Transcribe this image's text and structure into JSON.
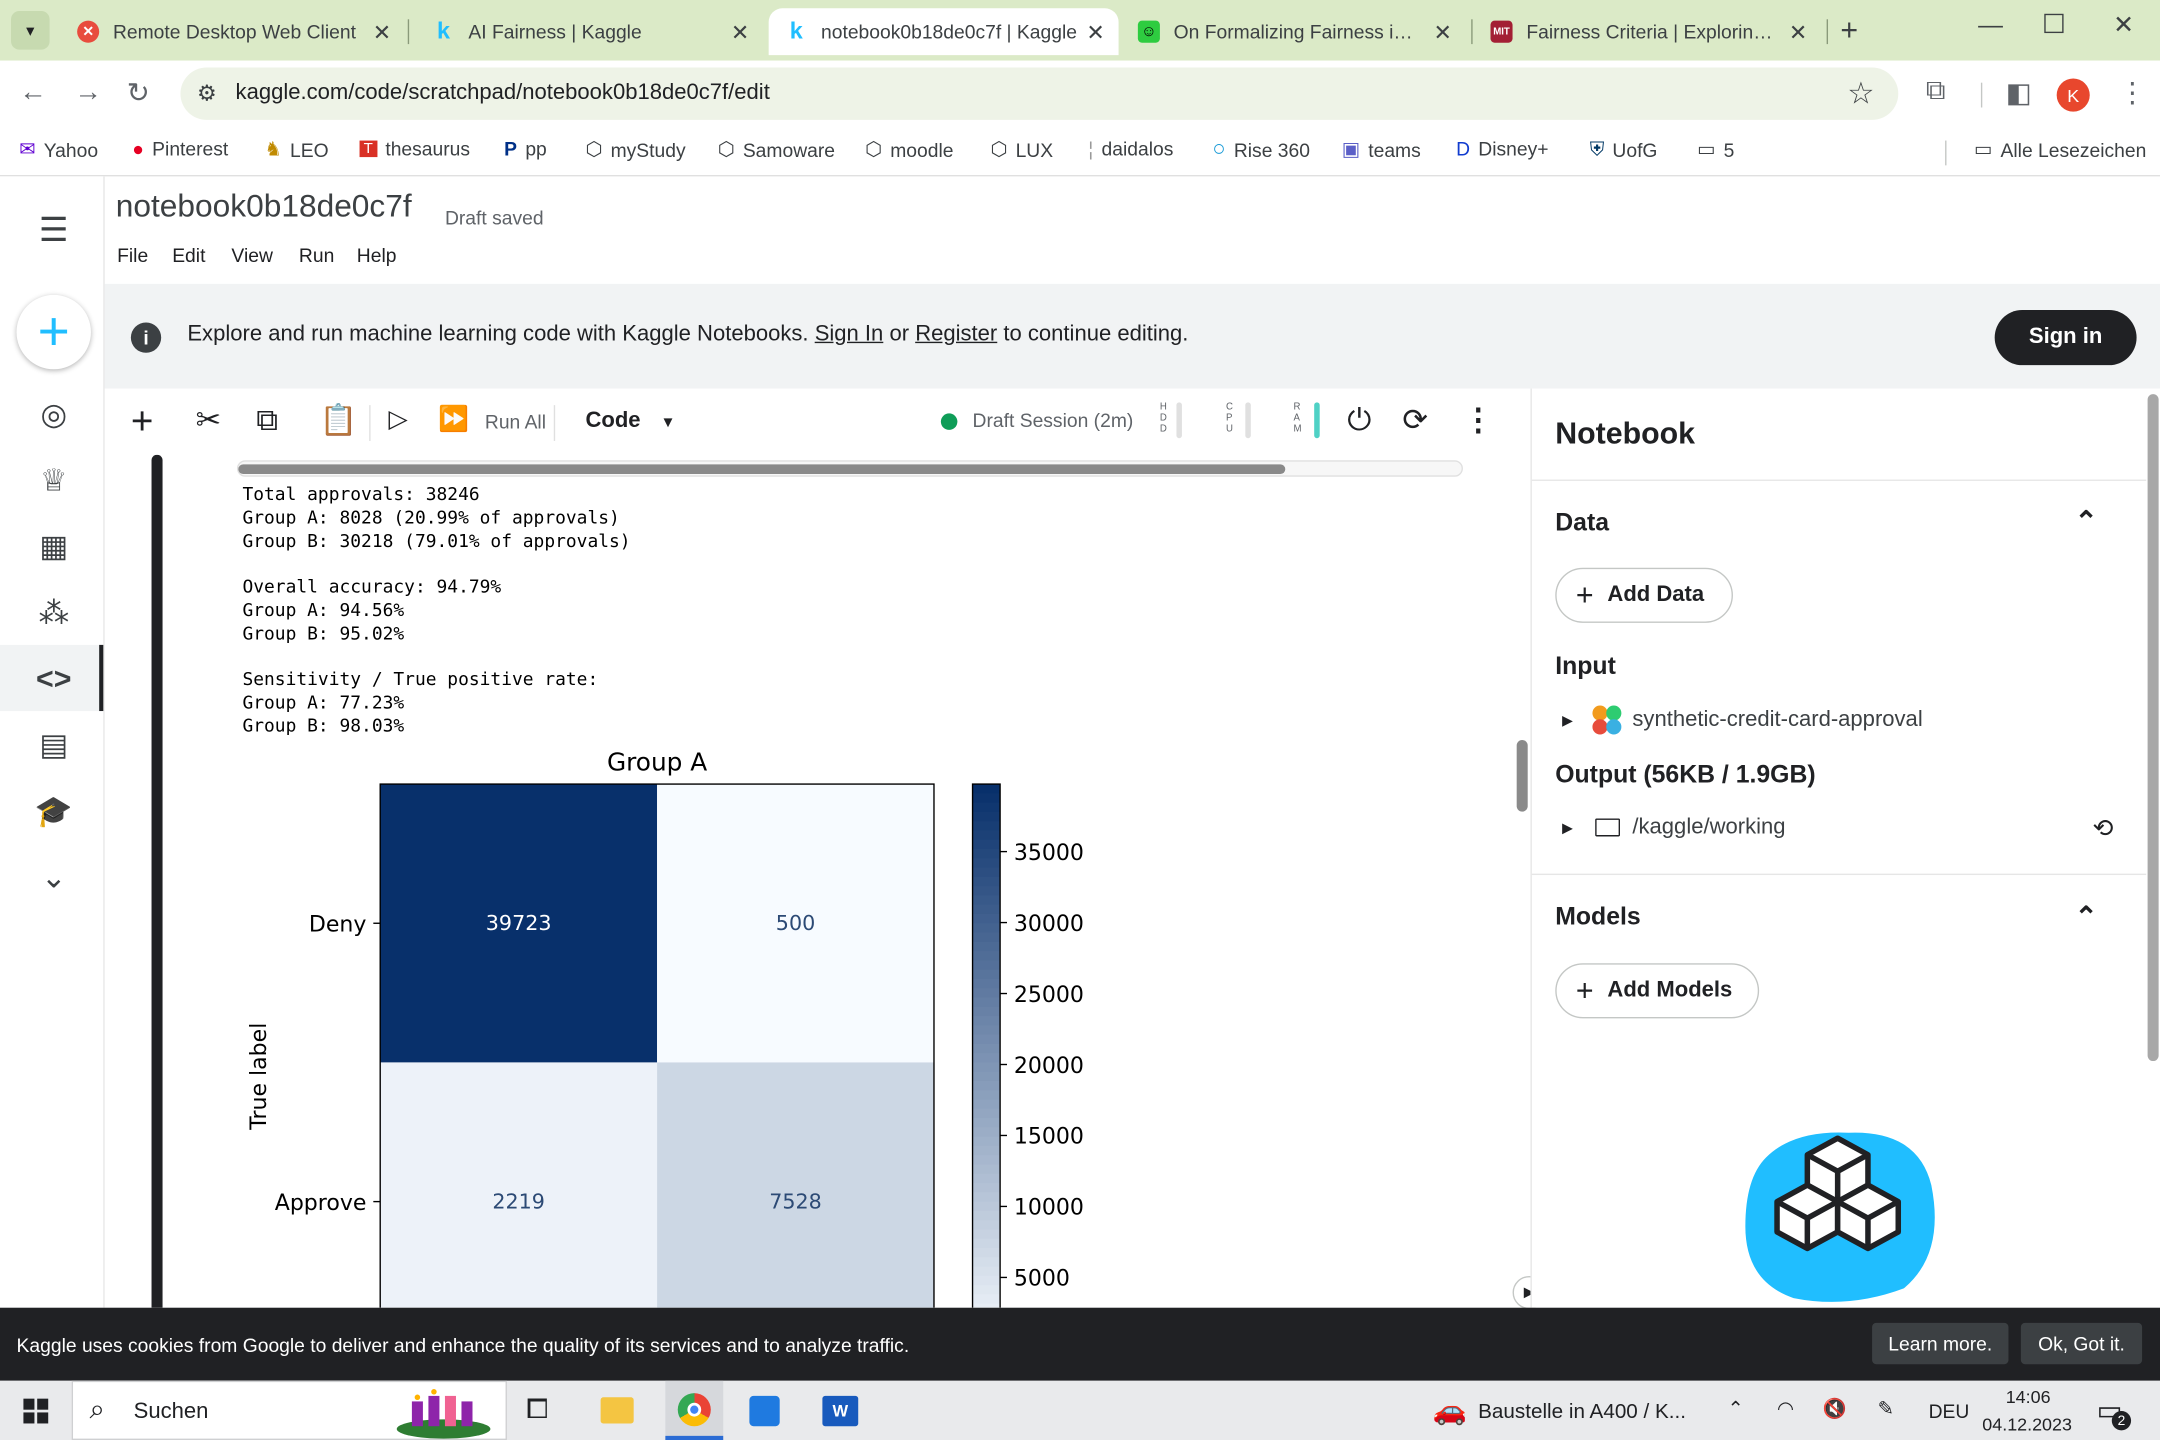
{
  "browser": {
    "tabs": [
      {
        "title": "Remote Desktop Web Client",
        "icon": "remote-desktop-icon",
        "active": false
      },
      {
        "title": "AI Fairness | Kaggle",
        "icon": "kaggle-icon",
        "active": false
      },
      {
        "title": "notebook0b18de0c7f | Kaggle",
        "icon": "kaggle-icon",
        "active": true
      },
      {
        "title": "On Formalizing Fairness in Prec",
        "icon": "smiley-icon",
        "active": false
      },
      {
        "title": "Fairness Criteria | Exploring Fair",
        "icon": "mit-icon",
        "active": false
      }
    ],
    "url": "kaggle.com/code/scratchpad/notebook0b18de0c7f/edit",
    "profile_initial": "K",
    "bookmarks": [
      "Yahoo",
      "Pinterest",
      "LEO",
      "thesaurus",
      "pp",
      "myStudy",
      "Samoware",
      "moodle",
      "LUX",
      "daidalos",
      "Rise 360",
      "teams",
      "Disney+",
      "UofG",
      "5"
    ],
    "all_bookmarks": "Alle Lesezeichen"
  },
  "notebook": {
    "title": "notebook0b18de0c7f",
    "status": "Draft saved",
    "menu": [
      "File",
      "Edit",
      "View",
      "Run",
      "Help"
    ]
  },
  "banner": {
    "text_before": "Explore and run machine learning code with Kaggle Notebooks.",
    "sign_in_link": "Sign In",
    "or": "or",
    "register_link": "Register",
    "text_after": "to continue editing.",
    "sign_in_button": "Sign in"
  },
  "toolbar": {
    "run_all": "Run All",
    "cell_type": "Code",
    "session": "Draft Session (2m)",
    "hdd": "HDD",
    "cpu": "CPU",
    "ram": "RAM"
  },
  "output_lines": [
    "Total approvals: 38246",
    "Group A: 8028 (20.99% of approvals)",
    "Group B: 30218 (79.01% of approvals)",
    "",
    "Overall accuracy: 94.79%",
    "Group A: 94.56%",
    "Group B: 95.02%",
    "",
    "Sensitivity / True positive rate:",
    "Group A: 77.23%",
    "Group B: 98.03%"
  ],
  "chart_data": {
    "type": "heatmap",
    "title": "Group A",
    "ylabel": "True label",
    "xlabel": "",
    "rows": [
      "Deny",
      "Approve"
    ],
    "values": [
      [
        39723,
        500
      ],
      [
        2219,
        7528
      ]
    ],
    "colormap": "Blues",
    "colorbar_ticks": [
      5000,
      10000,
      15000,
      20000,
      25000,
      30000,
      35000
    ],
    "colorbar_range": [
      500,
      39723
    ]
  },
  "right_panel": {
    "title": "Notebook",
    "data_header": "Data",
    "add_data": "Add Data",
    "input_header": "Input",
    "input_item": "synthetic-credit-card-approval",
    "output_header": "Output (56KB / 1.9GB)",
    "output_item": "/kaggle/working",
    "models_header": "Models",
    "add_models": "Add Models"
  },
  "cookie": {
    "message": "Kaggle uses cookies from Google to deliver and enhance the quality of its services and to analyze traffic.",
    "learn_more": "Learn more.",
    "ok": "Ok, Got it."
  },
  "taskbar": {
    "search": "Suchen",
    "notification": "Baustelle in A400 / K...",
    "lang": "DEU",
    "time": "14:06",
    "date": "04.12.2023",
    "badge": "2"
  },
  "colors": {
    "kaggle_blue": "#20beff",
    "tab_strip": "#dbeac7",
    "session_green": "#0f9d58"
  }
}
